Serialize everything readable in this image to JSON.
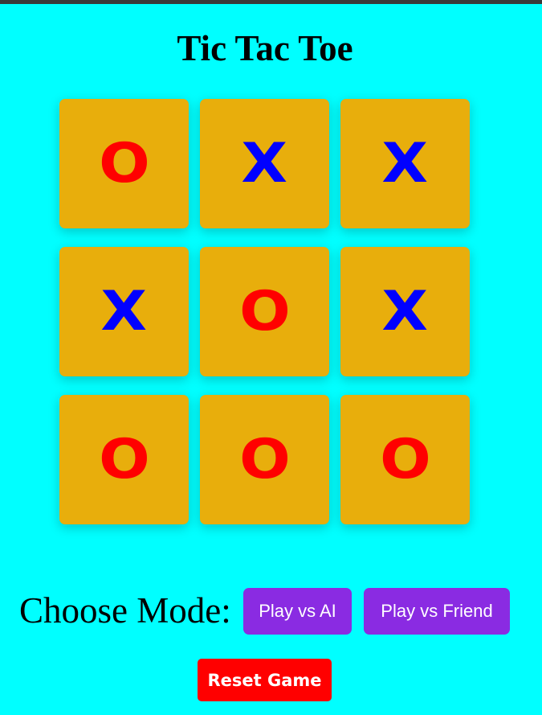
{
  "title": "Tic Tac Toe",
  "board": {
    "cells": [
      "O",
      "X",
      "X",
      "X",
      "O",
      "X",
      "O",
      "O",
      "O"
    ]
  },
  "colors": {
    "background": "#00ffff",
    "cell": "#e8ae0c",
    "x_mark": "#0000ff",
    "o_mark": "#ff0000",
    "mode_button": "#8a2be2",
    "reset_button": "#ff0000"
  },
  "mode": {
    "label": "Choose Mode:",
    "ai_label": "Play vs AI",
    "friend_label": "Play vs Friend"
  },
  "reset_label": "Reset Game"
}
